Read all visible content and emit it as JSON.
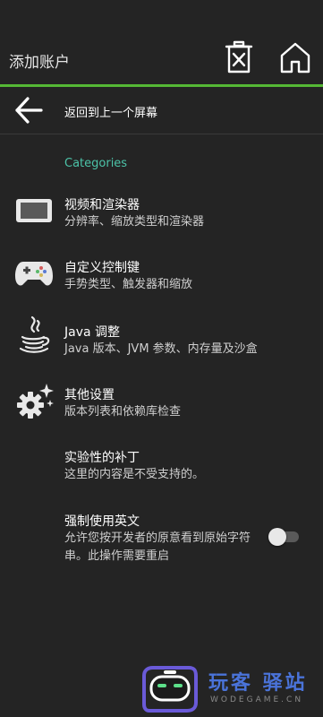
{
  "colors": {
    "accent": "#4cc3a8",
    "green_line": "#55b835",
    "background": "#242424"
  },
  "header": {
    "title": "添加账户",
    "icons": [
      "trash-icon",
      "home-icon"
    ]
  },
  "back": {
    "label": "返回到上一个屏幕"
  },
  "categories_header": "Categories",
  "items": [
    {
      "icon": "monitor-icon",
      "title": "视频和渲染器",
      "summary": "分辨率、缩放类型和渲染器"
    },
    {
      "icon": "gamepad-icon",
      "title": "自定义控制键",
      "summary": "手势类型、触发器和缩放"
    },
    {
      "icon": "java-icon",
      "title": "Java 调整",
      "summary": "Java 版本、JVM 参数、内存量及沙盒"
    },
    {
      "icon": "settings-gear-icon",
      "title": "其他设置",
      "summary": "版本列表和依赖库检查"
    },
    {
      "icon": "",
      "title": "实验性的补丁",
      "summary": "这里的内容是不受支持的。"
    },
    {
      "icon": "",
      "title": "强制使用英文",
      "summary": "允许您按开发者的原意看到原始字符串。此操作需要重启"
    }
  ],
  "force_english_toggle": {
    "on": false
  },
  "watermark": {
    "text": "玩客 驿站",
    "sub": "WODEGAME.CN"
  }
}
